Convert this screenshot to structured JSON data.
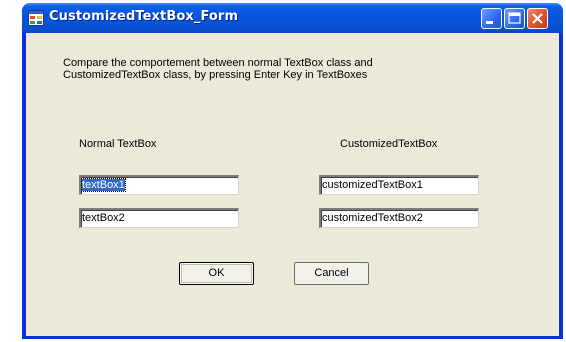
{
  "window": {
    "title": "CustomizedTextBox_Form",
    "icon": "form-app-icon"
  },
  "caption_buttons": [
    "minimize-icon",
    "maximize-icon",
    "close-icon"
  ],
  "description": {
    "line1": "Compare the comportement between normal TextBox class and",
    "line2": "CustomizedTextBox class, by pressing Enter Key in TextBoxes"
  },
  "labels": {
    "normal": "Normal TextBox",
    "customized": "CustomizedTextBox"
  },
  "textboxes": {
    "normal1": "textBox1",
    "normal2": "textBox2",
    "custom1": "customizedTextBox1",
    "custom2": "customizedTextBox2"
  },
  "buttons": {
    "ok": "OK",
    "cancel": "Cancel"
  },
  "colors": {
    "titlebar": "#0855dd",
    "client_background": "#ece9d8",
    "selection": "#316ac5",
    "close_button": "#e3522a"
  }
}
